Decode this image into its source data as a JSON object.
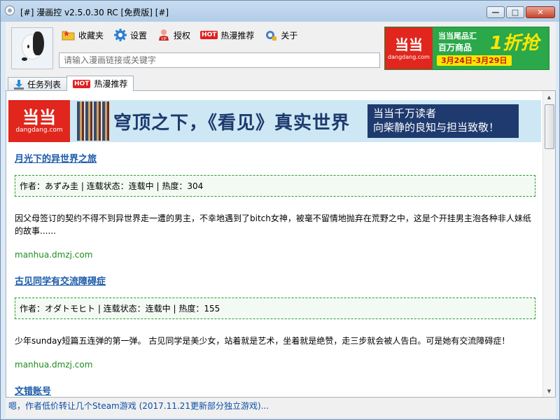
{
  "window": {
    "title": "[#] 漫画控 v2.5.0.30 RC [免费版] [#]",
    "buttons": {
      "minimize": "—",
      "maximize": "□",
      "close": "✕"
    }
  },
  "toolbar": {
    "items": [
      {
        "label": "收藏夹",
        "icon": "folder-star-icon"
      },
      {
        "label": "设置",
        "icon": "gear-icon"
      },
      {
        "label": "授权",
        "icon": "vip-icon"
      },
      {
        "label": "热漫推荐",
        "icon": "hot-icon",
        "badge": "HOT"
      },
      {
        "label": "关于",
        "icon": "about-icon"
      }
    ]
  },
  "search": {
    "placeholder": "请输入漫画链接或关键字",
    "value": ""
  },
  "top_ad": {
    "logo": "当当",
    "domain": "dangdang.com",
    "line1": "当当尾品汇",
    "line2": "百万商品",
    "highlight": "1折抢",
    "date": "3月24日-3月29日"
  },
  "tabs": [
    {
      "label": "任务列表",
      "active": false
    },
    {
      "label": "热漫推荐",
      "active": true,
      "badge": "HOT"
    }
  ],
  "banner": {
    "logo": "当当",
    "domain": "dangdang.com",
    "headline": "穹顶之下，《看见》真实世界",
    "box_line1": "当当千万读者",
    "box_line2": "向柴静的良知与担当致敬！"
  },
  "entries": [
    {
      "title": "月光下的异世界之旅",
      "meta": "作者：あずみ圭 | 连载状态：连载中 | 热度：304",
      "desc": "因父母签订的契约不得不到异世界走一遭的男主，不幸地遇到了bitch女神，被毫不留情地抛弃在荒野之中，这是个开挂男主泡各种非人妹纸的故事......",
      "source": "manhua.dmzj.com"
    },
    {
      "title": "古见同学有交流障碍症",
      "meta": "作者：オダトモヒト | 连载状态：连载中 | 热度：155",
      "desc": "少年sunday短篇五连弹的第一弹。 古见同学是美少女，站着就是艺术，坐着就是绝赞，走三步就会被人告白。可是她有交流障碍症！",
      "source": "manhua.dmzj.com"
    },
    {
      "title": "文错账号",
      "meta": "",
      "desc": "",
      "source": ""
    }
  ],
  "status": {
    "text": "嗯，作者低价转让几个Steam游戏 (2017.11.21更新部分独立游戏)..."
  }
}
